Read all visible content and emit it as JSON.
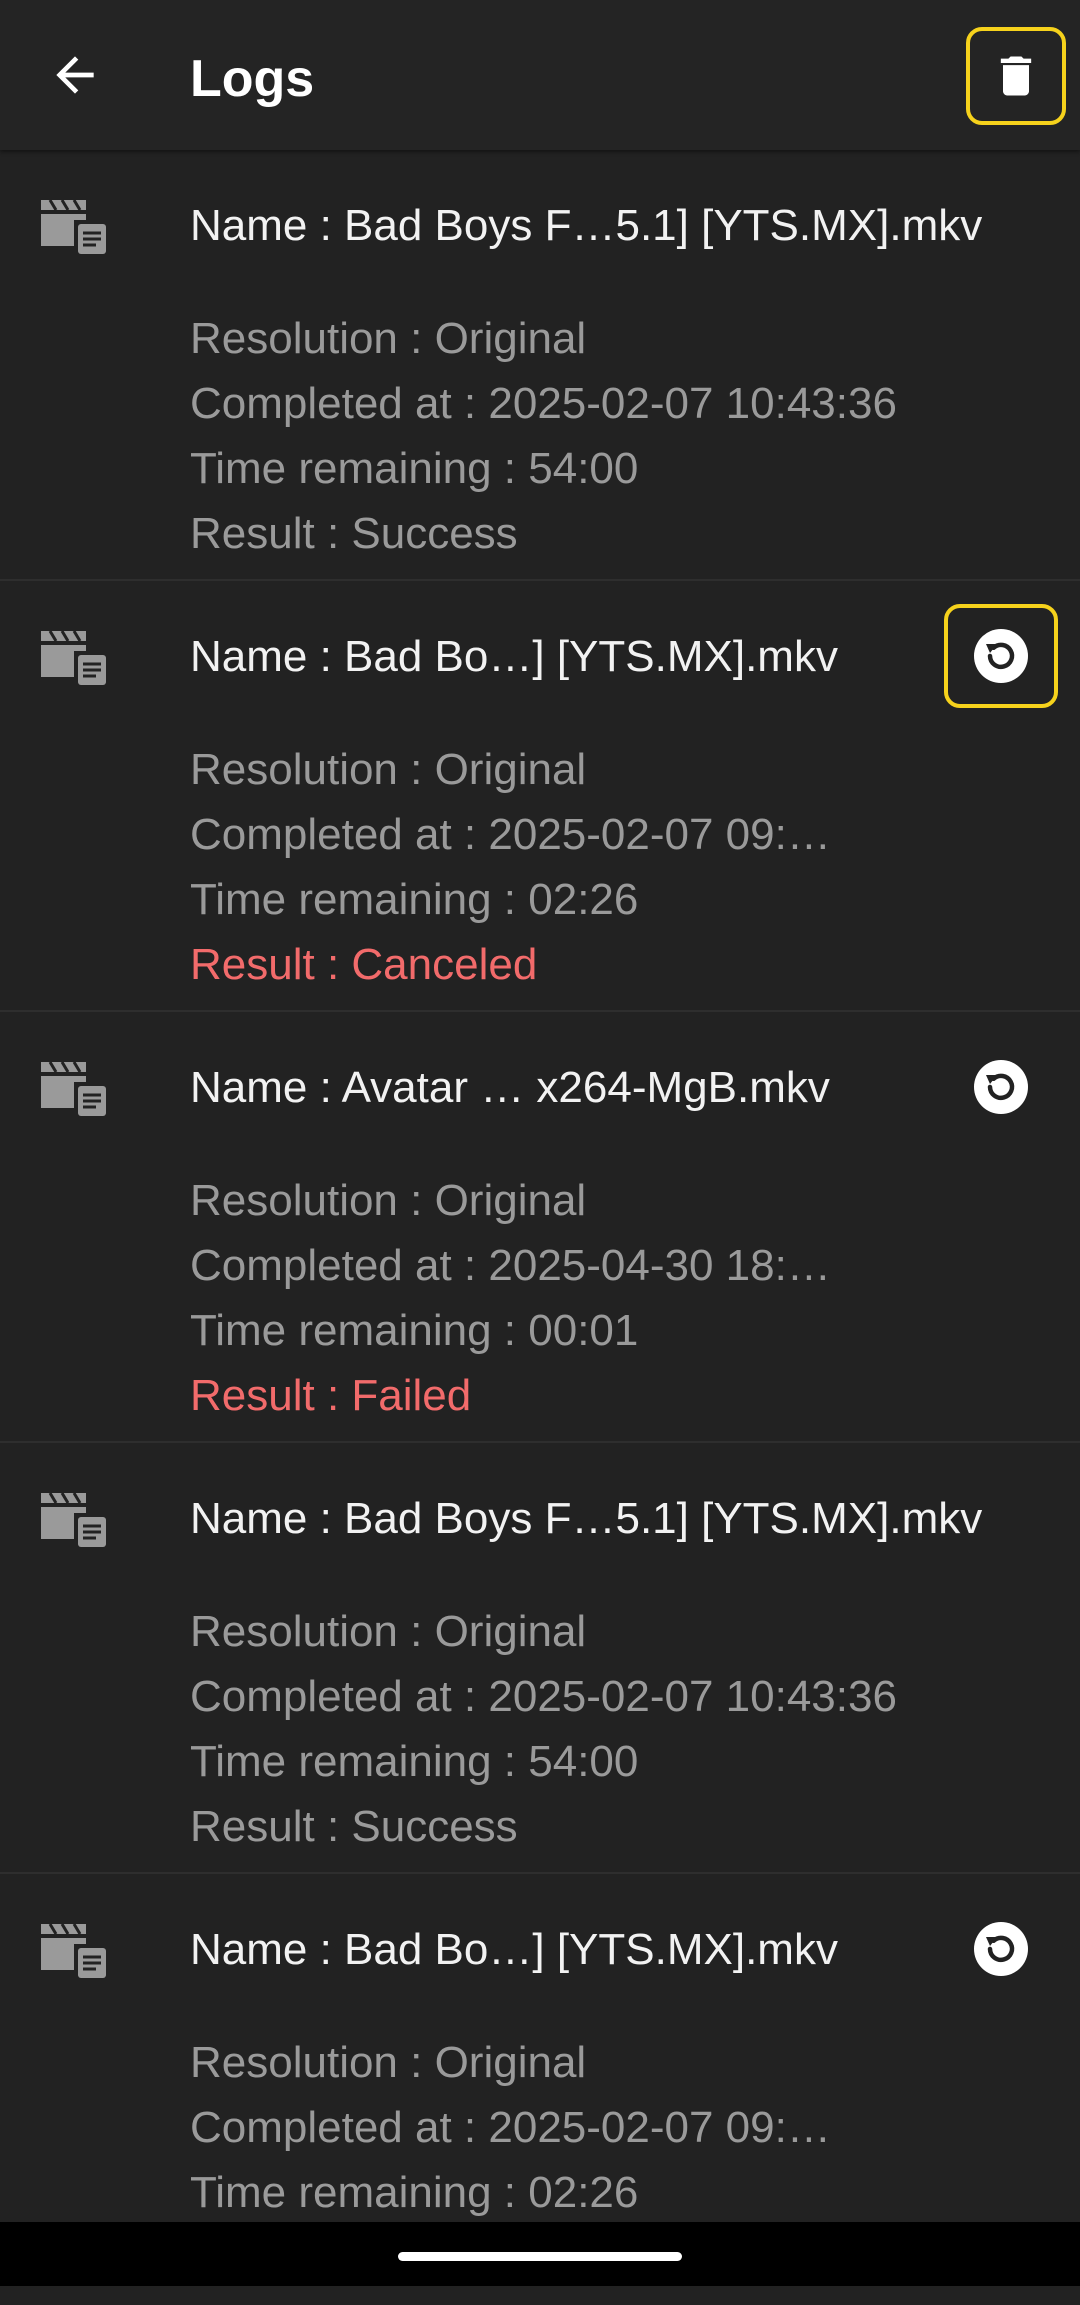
{
  "appbar": {
    "title": "Logs",
    "back_icon": "arrow-back-icon",
    "delete_icon": "trash-icon",
    "highlight_color": "#f6d21c"
  },
  "colors": {
    "background": "#222222",
    "name_text": "#f2f2f2",
    "detail_text": "#9a9a9a",
    "error_text": "#f26b6b"
  },
  "logs": [
    {
      "name": "Name : Bad Boys F…5.1] [YTS.MX].mkv",
      "resolution": "Resolution : Original",
      "completed": "Completed at : 2025-02-07 10:43:36",
      "remaining": "Time remaining : 54:00",
      "result": "Result : Success",
      "failed": false,
      "has_retry": false
    },
    {
      "name": "Name : Bad Bo…] [YTS.MX].mkv",
      "resolution": "Resolution : Original",
      "completed": "Completed at : 2025-02-07 09:…",
      "remaining": "Time remaining : 02:26",
      "result": "Result : Canceled",
      "failed": true,
      "has_retry": true,
      "retry_focused": true
    },
    {
      "name": "Name : Avatar … x264-MgB.mkv",
      "resolution": "Resolution : Original",
      "completed": "Completed at : 2025-04-30 18:…",
      "remaining": "Time remaining : 00:01",
      "result": "Result : Failed",
      "failed": true,
      "has_retry": true
    },
    {
      "name": "Name : Bad Boys F…5.1] [YTS.MX].mkv",
      "resolution": "Resolution : Original",
      "completed": "Completed at : 2025-02-07 10:43:36",
      "remaining": "Time remaining : 54:00",
      "result": "Result : Success",
      "failed": false,
      "has_retry": false
    },
    {
      "name": "Name : Bad Bo…] [YTS.MX].mkv",
      "resolution": "Resolution : Original",
      "completed": "Completed at : 2025-02-07 09:…",
      "remaining": "Time remaining : 02:26",
      "result": "",
      "failed": true,
      "has_retry": true
    }
  ]
}
